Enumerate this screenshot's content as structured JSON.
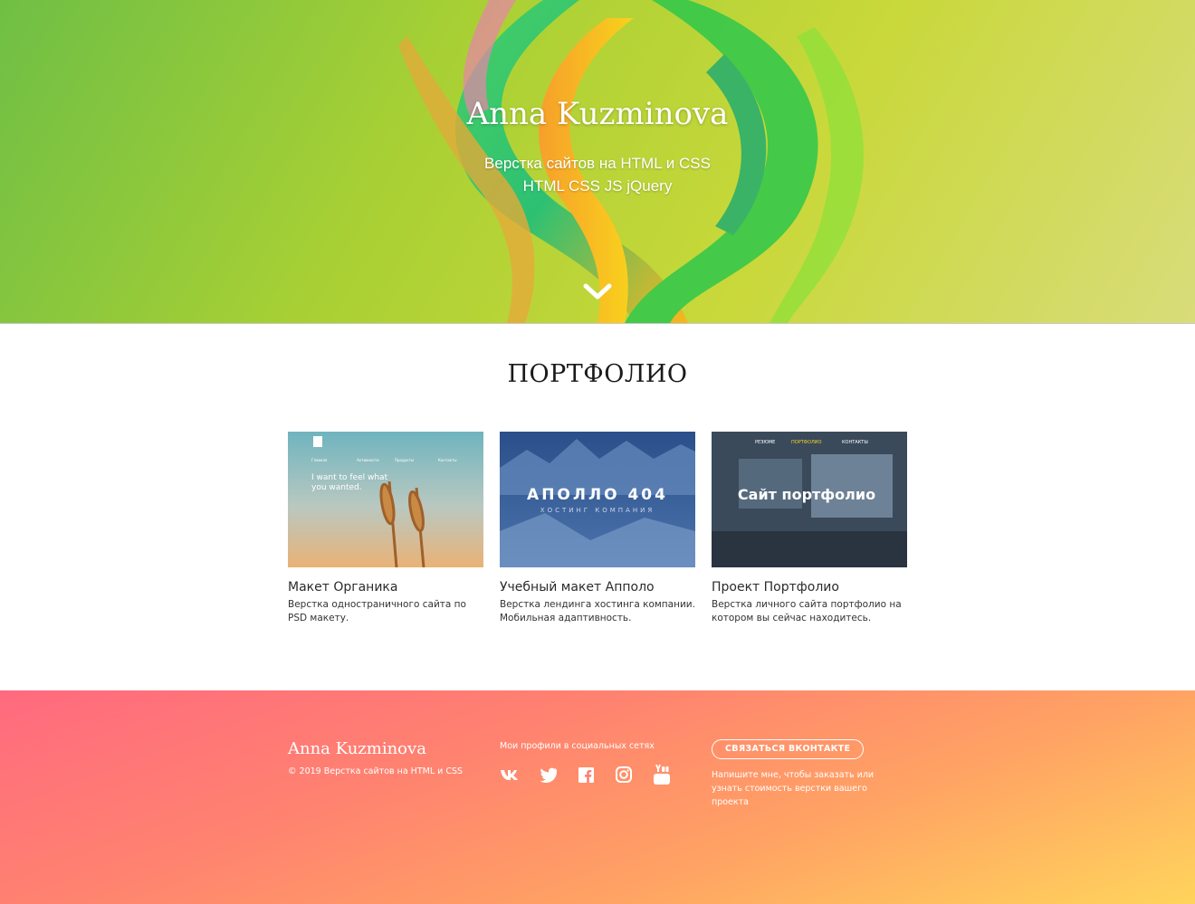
{
  "hero": {
    "title": "Anna Kuzminova",
    "subtitle_line1": "Верстка сайтов на HTML и CSS",
    "subtitle_line2": "HTML CSS JS jQuery",
    "scroll_icon": "chevron-down-icon"
  },
  "portfolio": {
    "heading": "ПОРТФОЛИО",
    "cards": [
      {
        "title": "Макет Органика",
        "description": "Верстка одностраничного сайта по PSD макету.",
        "thumb": {
          "nav": [
            "Главная",
            "Активности",
            "Продукты",
            "Контакты"
          ],
          "headline_line1": "I want to feel what",
          "headline_line2": "you wanted."
        }
      },
      {
        "title": "Учебный макет Апполо",
        "description": "Верстка лендинга хостинга компании. Мобильная адаптивность.",
        "thumb": {
          "headline": "АПОЛЛО 404",
          "subline": "ХОСТИНГ КОМПАНИЯ"
        }
      },
      {
        "title": "Проект Портфолио",
        "description": "Верстка личного сайта портфолио на котором вы сейчас находитесь.",
        "thumb": {
          "nav": [
            "РЕЗЮМЕ",
            "ПОРТФОЛИО",
            "КОНТАКТЫ"
          ],
          "headline": "Сайт портфолио"
        }
      }
    ]
  },
  "footer": {
    "name": "Anna Kuzminova",
    "copyright": "© 2019 Верстка сайтов на HTML и CSS",
    "social_heading": "Мои профили в социальных сетях",
    "social_icons": [
      "vk-icon",
      "twitter-icon",
      "facebook-icon",
      "instagram-icon",
      "youtube-icon"
    ],
    "contact_button": "СВЯЗАТЬСЯ ВКОНТАКТЕ",
    "contact_note": "Напишите мне, чтобы заказать или узнать стоимость верстки вашего проекта"
  },
  "colors": {
    "hero_green": "#a8d034",
    "footer_pink": "#ff6a7f",
    "footer_yellow": "#ffd45c",
    "text_dark": "#1a1a1a"
  }
}
